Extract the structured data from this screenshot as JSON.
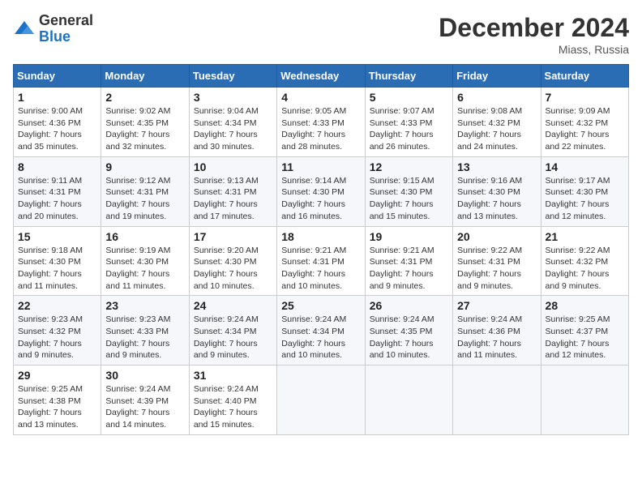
{
  "logo": {
    "general": "General",
    "blue": "Blue"
  },
  "title": "December 2024",
  "subtitle": "Miass, Russia",
  "days_of_week": [
    "Sunday",
    "Monday",
    "Tuesday",
    "Wednesday",
    "Thursday",
    "Friday",
    "Saturday"
  ],
  "weeks": [
    [
      {
        "day": "1",
        "sunrise": "9:00 AM",
        "sunset": "4:36 PM",
        "daylight": "7 hours and 35 minutes."
      },
      {
        "day": "2",
        "sunrise": "9:02 AM",
        "sunset": "4:35 PM",
        "daylight": "7 hours and 32 minutes."
      },
      {
        "day": "3",
        "sunrise": "9:04 AM",
        "sunset": "4:34 PM",
        "daylight": "7 hours and 30 minutes."
      },
      {
        "day": "4",
        "sunrise": "9:05 AM",
        "sunset": "4:33 PM",
        "daylight": "7 hours and 28 minutes."
      },
      {
        "day": "5",
        "sunrise": "9:07 AM",
        "sunset": "4:33 PM",
        "daylight": "7 hours and 26 minutes."
      },
      {
        "day": "6",
        "sunrise": "9:08 AM",
        "sunset": "4:32 PM",
        "daylight": "7 hours and 24 minutes."
      },
      {
        "day": "7",
        "sunrise": "9:09 AM",
        "sunset": "4:32 PM",
        "daylight": "7 hours and 22 minutes."
      }
    ],
    [
      {
        "day": "8",
        "sunrise": "9:11 AM",
        "sunset": "4:31 PM",
        "daylight": "7 hours and 20 minutes."
      },
      {
        "day": "9",
        "sunrise": "9:12 AM",
        "sunset": "4:31 PM",
        "daylight": "7 hours and 19 minutes."
      },
      {
        "day": "10",
        "sunrise": "9:13 AM",
        "sunset": "4:31 PM",
        "daylight": "7 hours and 17 minutes."
      },
      {
        "day": "11",
        "sunrise": "9:14 AM",
        "sunset": "4:30 PM",
        "daylight": "7 hours and 16 minutes."
      },
      {
        "day": "12",
        "sunrise": "9:15 AM",
        "sunset": "4:30 PM",
        "daylight": "7 hours and 15 minutes."
      },
      {
        "day": "13",
        "sunrise": "9:16 AM",
        "sunset": "4:30 PM",
        "daylight": "7 hours and 13 minutes."
      },
      {
        "day": "14",
        "sunrise": "9:17 AM",
        "sunset": "4:30 PM",
        "daylight": "7 hours and 12 minutes."
      }
    ],
    [
      {
        "day": "15",
        "sunrise": "9:18 AM",
        "sunset": "4:30 PM",
        "daylight": "7 hours and 11 minutes."
      },
      {
        "day": "16",
        "sunrise": "9:19 AM",
        "sunset": "4:30 PM",
        "daylight": "7 hours and 11 minutes."
      },
      {
        "day": "17",
        "sunrise": "9:20 AM",
        "sunset": "4:30 PM",
        "daylight": "7 hours and 10 minutes."
      },
      {
        "day": "18",
        "sunrise": "9:21 AM",
        "sunset": "4:31 PM",
        "daylight": "7 hours and 10 minutes."
      },
      {
        "day": "19",
        "sunrise": "9:21 AM",
        "sunset": "4:31 PM",
        "daylight": "7 hours and 9 minutes."
      },
      {
        "day": "20",
        "sunrise": "9:22 AM",
        "sunset": "4:31 PM",
        "daylight": "7 hours and 9 minutes."
      },
      {
        "day": "21",
        "sunrise": "9:22 AM",
        "sunset": "4:32 PM",
        "daylight": "7 hours and 9 minutes."
      }
    ],
    [
      {
        "day": "22",
        "sunrise": "9:23 AM",
        "sunset": "4:32 PM",
        "daylight": "7 hours and 9 minutes."
      },
      {
        "day": "23",
        "sunrise": "9:23 AM",
        "sunset": "4:33 PM",
        "daylight": "7 hours and 9 minutes."
      },
      {
        "day": "24",
        "sunrise": "9:24 AM",
        "sunset": "4:34 PM",
        "daylight": "7 hours and 9 minutes."
      },
      {
        "day": "25",
        "sunrise": "9:24 AM",
        "sunset": "4:34 PM",
        "daylight": "7 hours and 10 minutes."
      },
      {
        "day": "26",
        "sunrise": "9:24 AM",
        "sunset": "4:35 PM",
        "daylight": "7 hours and 10 minutes."
      },
      {
        "day": "27",
        "sunrise": "9:24 AM",
        "sunset": "4:36 PM",
        "daylight": "7 hours and 11 minutes."
      },
      {
        "day": "28",
        "sunrise": "9:25 AM",
        "sunset": "4:37 PM",
        "daylight": "7 hours and 12 minutes."
      }
    ],
    [
      {
        "day": "29",
        "sunrise": "9:25 AM",
        "sunset": "4:38 PM",
        "daylight": "7 hours and 13 minutes."
      },
      {
        "day": "30",
        "sunrise": "9:24 AM",
        "sunset": "4:39 PM",
        "daylight": "7 hours and 14 minutes."
      },
      {
        "day": "31",
        "sunrise": "9:24 AM",
        "sunset": "4:40 PM",
        "daylight": "7 hours and 15 minutes."
      },
      null,
      null,
      null,
      null
    ]
  ]
}
